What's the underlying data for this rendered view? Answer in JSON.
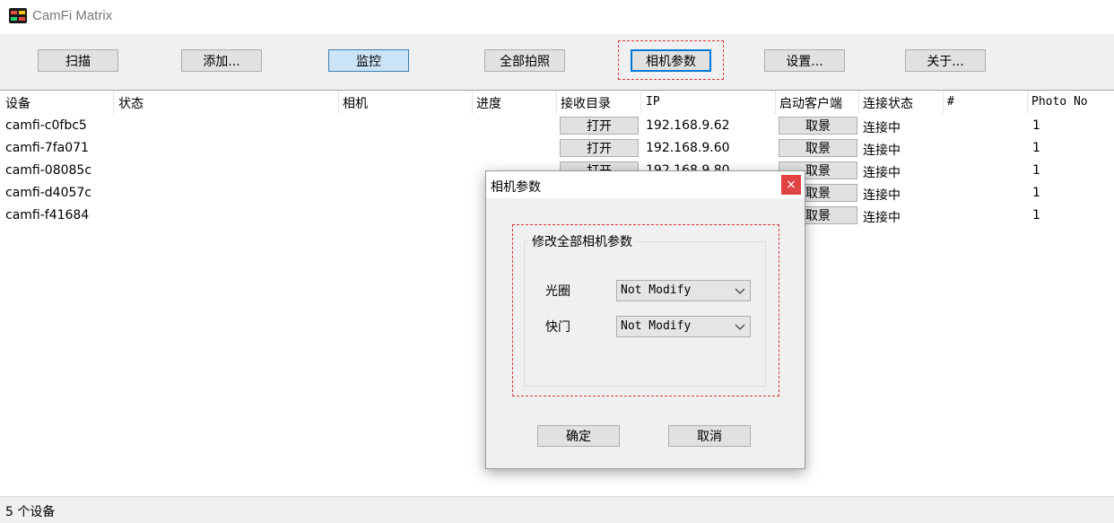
{
  "app": {
    "title": "CamFi Matrix"
  },
  "toolbar": {
    "scan": "扫描",
    "add": "添加...",
    "monitor": "监控",
    "capture_all": "全部拍照",
    "camera_params": "相机参数",
    "settings": "设置...",
    "about": "关于..."
  },
  "table": {
    "headers": [
      "设备",
      "状态",
      "相机",
      "进度",
      "接收目录",
      "IP",
      "启动客户端",
      "连接状态",
      "#",
      "Photo No"
    ],
    "rows": [
      {
        "device": "camfi-c0fbc5",
        "open": "打开",
        "ip": "192.168.9.62",
        "client": "取景",
        "conn": "连接中",
        "photo": "1"
      },
      {
        "device": "camfi-7fa071",
        "open": "打开",
        "ip": "192.168.9.60",
        "client": "取景",
        "conn": "连接中",
        "photo": "1"
      },
      {
        "device": "camfi-08085c",
        "open": "打开",
        "ip": "192.168.9.80",
        "client": "取景",
        "conn": "连接中",
        "photo": "1"
      },
      {
        "device": "camfi-d4057c",
        "open": "",
        "ip": "",
        "client": "取景",
        "conn": "连接中",
        "photo": "1"
      },
      {
        "device": "camfi-f41684",
        "open": "",
        "ip": "",
        "client": "取景",
        "conn": "连接中",
        "photo": "1"
      }
    ]
  },
  "status": {
    "text": "5 个设备"
  },
  "dialog": {
    "title": "相机参数",
    "close": "×",
    "group_label": "修改全部相机参数",
    "aperture_label": "光圈",
    "aperture_value": "Not Modify",
    "shutter_label": "快门",
    "shutter_value": "Not Modify",
    "ok": "确定",
    "cancel": "取消"
  },
  "colors": {
    "highlight_dash": "#d9363e",
    "close_button": "#e04343",
    "active_button": "#cce4f7"
  }
}
